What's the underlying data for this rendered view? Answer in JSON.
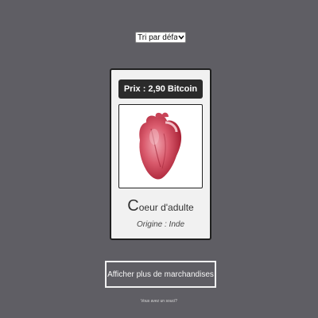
{
  "sort": {
    "selected": "Tri par défa"
  },
  "product": {
    "price_label": "Prix : 2,90 Bitcoin",
    "title_initial": "C",
    "title_rest": "oeur d'adulte",
    "origin": "Origine : Inde",
    "image_icon": "heart-image"
  },
  "more_button": {
    "label": "Afficher plus de marchandises"
  },
  "footer": {
    "link_text": "Vous avez un souci?"
  },
  "colors": {
    "background": "#5f5e64",
    "card": "#f1f1f1",
    "price_bar": "#2b2b2b"
  }
}
